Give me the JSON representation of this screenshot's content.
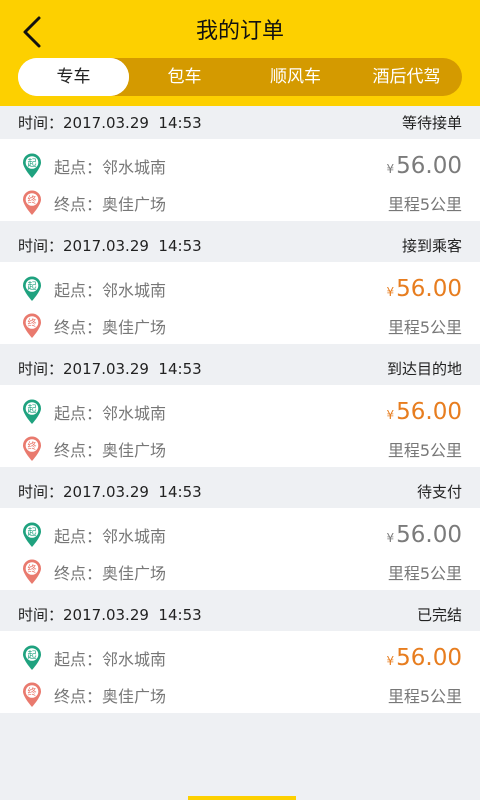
{
  "header": {
    "title": "我的订单",
    "tabs": [
      "专车",
      "包车",
      "顺风车",
      "酒后代驾"
    ],
    "active_tab": 0,
    "colors": {
      "bar": "#fdd000",
      "tab_track": "#d49a00"
    }
  },
  "labels": {
    "time_prefix": "时间：",
    "start_prefix": "起点：",
    "end_prefix": "终点：",
    "start_pin_char": "起",
    "end_pin_char": "终",
    "currency": "¥"
  },
  "orders": [
    {
      "time": "2017.03.29  14:53",
      "status": "等待接单",
      "start": "邻水城南",
      "end": "奥佳广场",
      "price": "56.00",
      "price_color": "#7b7b7b",
      "distance": "里程5公里"
    },
    {
      "time": "2017.03.29  14:53",
      "status": "接到乘客",
      "start": "邻水城南",
      "end": "奥佳广场",
      "price": "56.00",
      "price_color": "#e77d1f",
      "distance": "里程5公里"
    },
    {
      "time": "2017.03.29  14:53",
      "status": "到达目的地",
      "start": "邻水城南",
      "end": "奥佳广场",
      "price": "56.00",
      "price_color": "#e77d1f",
      "distance": "里程5公里"
    },
    {
      "time": "2017.03.29  14:53",
      "status": "待支付",
      "start": "邻水城南",
      "end": "奥佳广场",
      "price": "56.00",
      "price_color": "#7b7b7b",
      "distance": "里程5公里"
    },
    {
      "time": "2017.03.29  14:53",
      "status": "已完结",
      "start": "邻水城南",
      "end": "奥佳广场",
      "price": "56.00",
      "price_color": "#e77d1f",
      "distance": "里程5公里"
    }
  ]
}
